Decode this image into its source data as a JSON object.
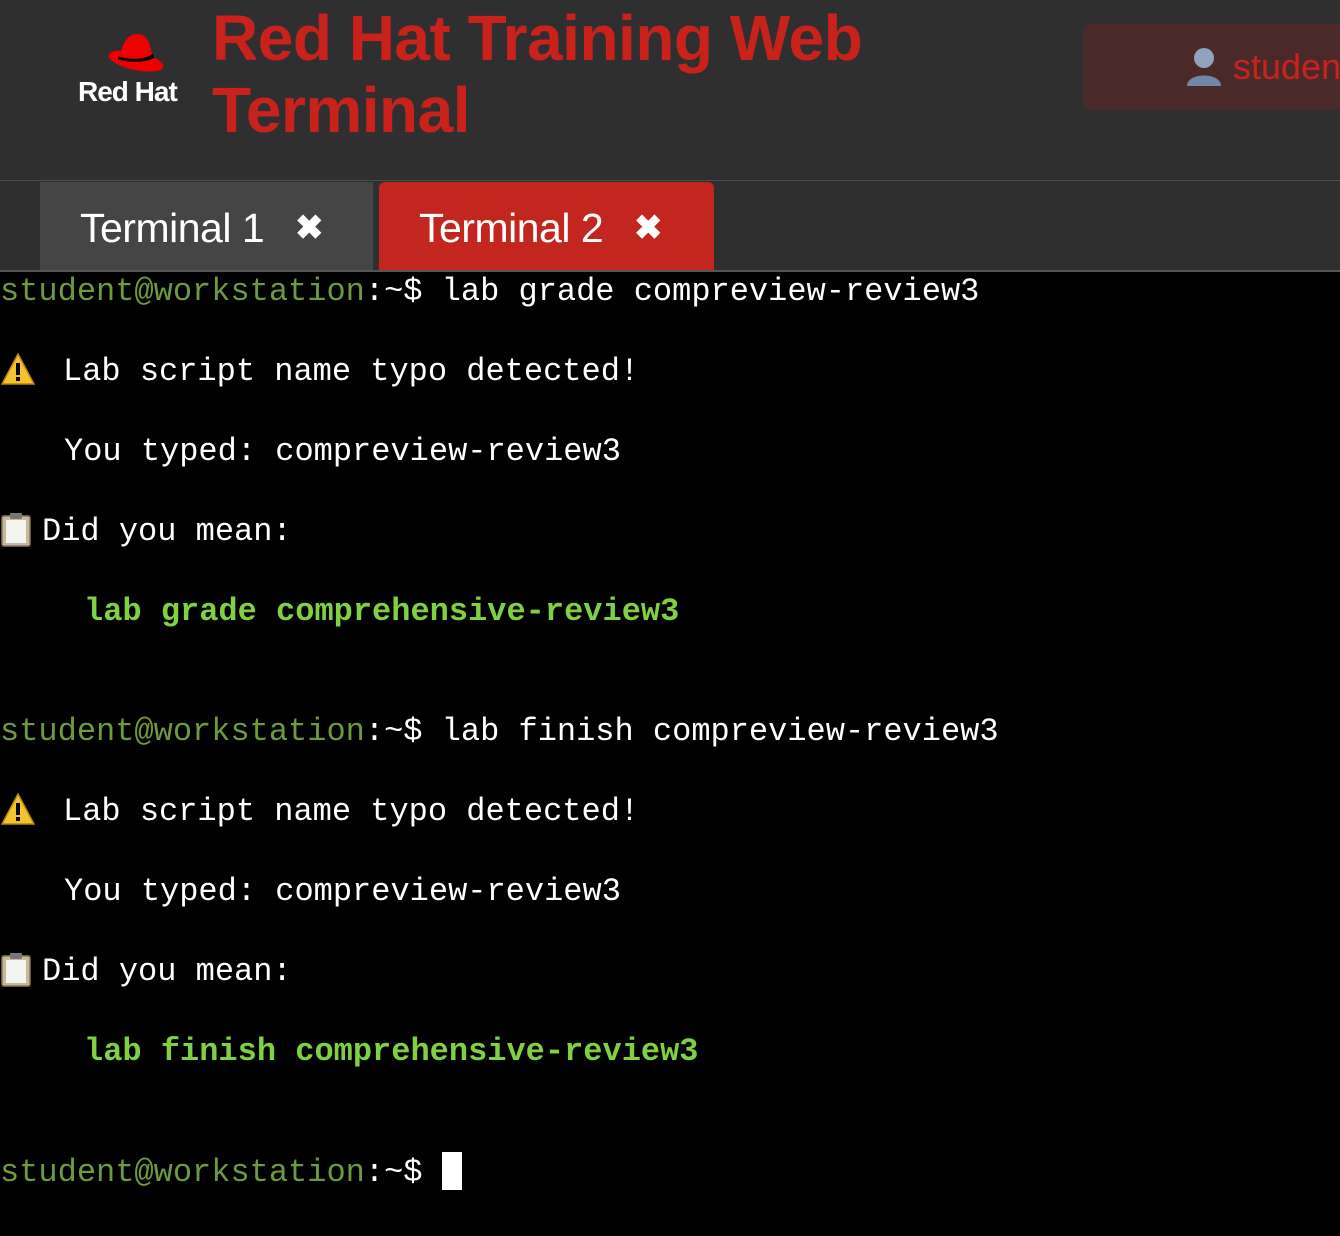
{
  "header": {
    "logo_text": "Red Hat",
    "title": "Red Hat Training Web Terminal",
    "user_label": "studen"
  },
  "tabs": [
    {
      "label": "Terminal 1",
      "close": "✖",
      "active": false
    },
    {
      "label": "Terminal 2",
      "close": "✖",
      "active": true
    }
  ],
  "terminal": {
    "prompt_user": "student@workstation",
    "prompt_sep": ":~$",
    "blocks": [
      {
        "command": " lab grade compreview-review3",
        "warning": "Lab script name typo detected!",
        "typed": "You typed: compreview-review3",
        "did_you_mean": "Did you mean:",
        "suggestion": "lab grade comprehensive-review3"
      },
      {
        "command": " lab finish compreview-review3",
        "warning": "Lab script name typo detected!",
        "typed": "You typed: compreview-review3",
        "did_you_mean": "Did you mean:",
        "suggestion": "lab finish comprehensive-review3"
      }
    ],
    "final_prompt_tail": " "
  },
  "colors": {
    "accent_red": "#c9221c",
    "prompt_green": "#6e9a3e",
    "suggestion_green": "#7fd142"
  },
  "icons": [
    "redhat-logo-icon",
    "user-icon",
    "close-icon",
    "warning-icon",
    "clipboard-icon"
  ]
}
